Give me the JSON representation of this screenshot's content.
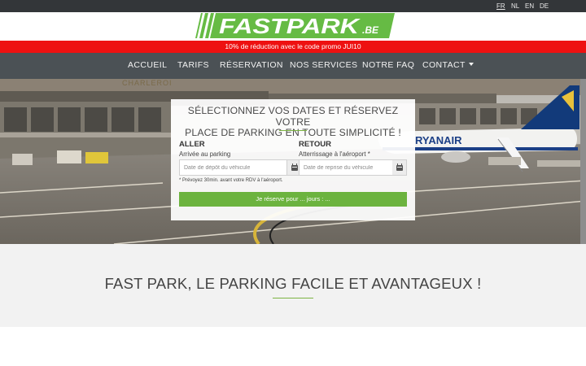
{
  "languages": [
    {
      "label": "FR",
      "active": true
    },
    {
      "label": "NL",
      "active": false
    },
    {
      "label": "EN",
      "active": false
    },
    {
      "label": "DE",
      "active": false
    }
  ],
  "logo": {
    "text": "FASTPARK",
    "suffix": ".BE"
  },
  "promo_banner": "10% de réduction avec le code promo JUI10",
  "nav": {
    "items": [
      "ACCUEIL",
      "TARIFS",
      "RÉSERVATION",
      "NOS SERVICES",
      "NOTRE FAQ",
      "CONTACT"
    ]
  },
  "booking": {
    "title_line1": "SÉLECTIONNEZ VOS DATES ET RÉSERVEZ VOTRE",
    "title_line2": "PLACE DE PARKING EN TOUTE SIMPLICITÉ !",
    "outbound": {
      "heading": "ALLER",
      "label": "Arrivée au parking",
      "placeholder": "Date de dépôt du véhicule"
    },
    "return": {
      "heading": "RETOUR",
      "label": "Atterrissage à l'aéroport *",
      "placeholder": "Date de reprise du véhicule"
    },
    "note": "* Prévoyez 30min. avant votre RDV à l'aéroport.",
    "button_label": "Je réserve pour ... jours : ..."
  },
  "hero": {
    "sign_text": "CHARLEROI",
    "plane_text": "RYANAIR"
  },
  "section": {
    "title": "FAST PARK, LE PARKING FACILE ET AVANTAGEUX !"
  },
  "colors": {
    "accent_green": "#6cb33f",
    "promo_red": "#ee1111",
    "nav_gray": "#4b5155",
    "topbar": "#333639"
  }
}
